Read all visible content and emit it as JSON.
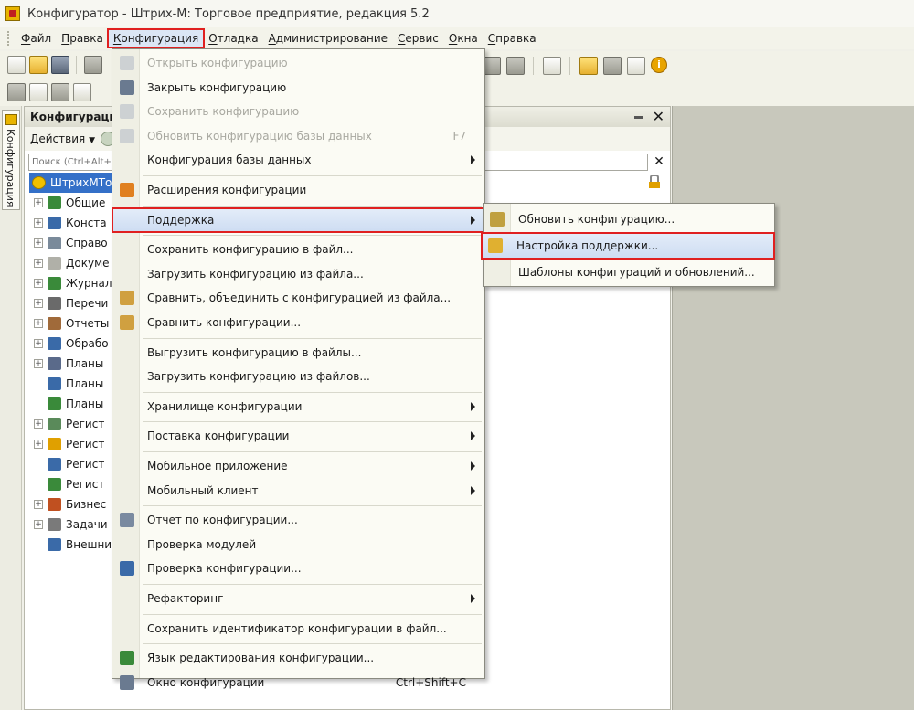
{
  "window": {
    "title": "Конфигуратор - Штрих-М: Торговое предприятие, редакция 5.2"
  },
  "menubar": {
    "items": [
      "Файл",
      "Правка",
      "Конфигурация",
      "Отладка",
      "Администрирование",
      "Сервис",
      "Окна",
      "Справка"
    ],
    "active": "Конфигурация"
  },
  "side_tab": {
    "label": "Конфигурация"
  },
  "panel": {
    "title": "Конфигурация",
    "actions_label": "Действия",
    "search_placeholder": "Поиск (Ctrl+Alt+I)",
    "root_label": "ШтрихМТорг",
    "tree_items": [
      {
        "label": "Общие",
        "expandable": true,
        "icon_color": "#3a8a3a"
      },
      {
        "label": "Конста",
        "expandable": true,
        "icon_color": "#3a6aa8"
      },
      {
        "label": "Справо",
        "expandable": true,
        "icon_color": "#7a8a9a"
      },
      {
        "label": "Докуме",
        "expandable": true,
        "icon_color": "#b0b0a8"
      },
      {
        "label": "Журнал",
        "expandable": true,
        "icon_color": "#3a8a3a"
      },
      {
        "label": "Перечи",
        "expandable": true,
        "icon_color": "#6a6a6a"
      },
      {
        "label": "Отчеты",
        "expandable": true,
        "icon_color": "#a06a3a"
      },
      {
        "label": "Обрабо",
        "expandable": true,
        "icon_color": "#3a6aa8"
      },
      {
        "label": "Планы",
        "expandable": true,
        "icon_color": "#5a6a8a"
      },
      {
        "label": "Планы",
        "expandable": false,
        "icon_color": "#3a6aa8"
      },
      {
        "label": "Планы",
        "expandable": false,
        "icon_color": "#3a8a3a"
      },
      {
        "label": "Регист",
        "expandable": true,
        "icon_color": "#5a8a5a"
      },
      {
        "label": "Регист",
        "expandable": true,
        "icon_color": "#e0a000"
      },
      {
        "label": "Регист",
        "expandable": false,
        "icon_color": "#3a6aa8"
      },
      {
        "label": "Регист",
        "expandable": false,
        "icon_color": "#3a8a3a"
      },
      {
        "label": "Бизнес",
        "expandable": true,
        "icon_color": "#c05020"
      },
      {
        "label": "Задачи",
        "expandable": true,
        "icon_color": "#7a7a7a"
      },
      {
        "label": "Внешни",
        "expandable": false,
        "icon_color": "#3a6aa8"
      }
    ]
  },
  "config_menu": {
    "items": [
      {
        "label": "Открыть конфигурацию",
        "disabled": true,
        "icon_color": "#9aa6b8"
      },
      {
        "label": "Закрыть конфигурацию",
        "disabled": false,
        "icon_color": "#6a7a90"
      },
      {
        "label": "Сохранить конфигурацию",
        "disabled": true,
        "icon_color": "#9aa6b8"
      },
      {
        "label": "Обновить конфигурацию базы данных",
        "shortcut": "F7",
        "disabled": true,
        "icon_color": "#9aa6b8"
      },
      {
        "label": "Конфигурация базы данных",
        "submenu": true
      },
      {
        "separator": true
      },
      {
        "label": "Расширения конфигурации",
        "icon_color": "#e08020"
      },
      {
        "separator": true
      },
      {
        "label": "Поддержка",
        "submenu": true,
        "highlight": true
      },
      {
        "separator": true
      },
      {
        "label": "Сохранить конфигурацию в файл..."
      },
      {
        "label": "Загрузить конфигурацию из файла..."
      },
      {
        "label": "Сравнить, объединить с конфигурацией из файла...",
        "icon_color": "#d0a040"
      },
      {
        "label": "Сравнить конфигурации...",
        "icon_color": "#d0a040"
      },
      {
        "separator": true
      },
      {
        "label": "Выгрузить конфигурацию в файлы..."
      },
      {
        "label": "Загрузить конфигурацию из файлов..."
      },
      {
        "separator": true
      },
      {
        "label": "Хранилище конфигурации",
        "submenu": true
      },
      {
        "separator": true
      },
      {
        "label": "Поставка конфигурации",
        "submenu": true
      },
      {
        "separator": true
      },
      {
        "label": "Мобильное приложение",
        "submenu": true
      },
      {
        "label": "Мобильный клиент",
        "submenu": true
      },
      {
        "separator": true
      },
      {
        "label": "Отчет по конфигурации...",
        "icon_color": "#7a8aa0"
      },
      {
        "label": "Проверка модулей"
      },
      {
        "label": "Проверка конфигурации...",
        "icon_color": "#3a6aa8"
      },
      {
        "separator": true
      },
      {
        "label": "Рефакторинг",
        "submenu": true
      },
      {
        "separator": true
      },
      {
        "label": "Сохранить идентификатор конфигурации в файл..."
      },
      {
        "separator": true
      },
      {
        "label": "Язык редактирования конфигурации...",
        "icon_color": "#3a8a3a"
      },
      {
        "label": "Окно конфигурации",
        "shortcut": "Ctrl+Shift+C",
        "icon_color": "#6a7a90"
      }
    ]
  },
  "support_submenu": {
    "items": [
      {
        "label": "Обновить конфигурацию...",
        "icon_color": "#c0a040"
      },
      {
        "label": "Настройка поддержки...",
        "highlight": true,
        "icon_color": "#e0b030"
      },
      {
        "label": "Шаблоны конфигураций и обновлений..."
      }
    ]
  }
}
